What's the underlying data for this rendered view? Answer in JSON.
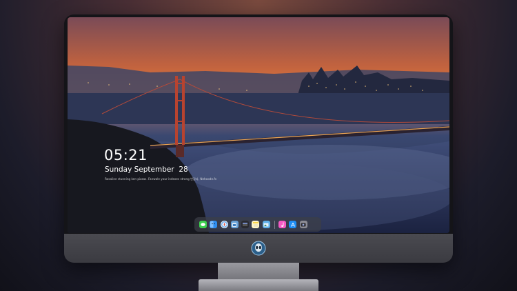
{
  "lock_screen": {
    "time": "05:21",
    "date": "Sunday September  28",
    "tagline": "Rosaline stunning ken pizzas. Fanwale your indexes strong 반갑다, Nehoode.fs"
  },
  "dock": {
    "apps": [
      {
        "name": "messages-icon",
        "color": "#3ccf4e"
      },
      {
        "name": "finder-icon",
        "color": "#2f8ef0"
      },
      {
        "name": "safari-icon",
        "color": "#e9eef5"
      },
      {
        "name": "preview-icon",
        "color": "#6aa3d9"
      },
      {
        "name": "final-cut-icon",
        "color": "#2a2a30"
      },
      {
        "name": "notes-icon",
        "color": "#f7d44c"
      },
      {
        "name": "photos-icon",
        "color": "#5fb0e8"
      },
      {
        "name": "itunes-icon",
        "color": "#f45ac4"
      },
      {
        "name": "app-store-icon",
        "color": "#1e8ef5"
      },
      {
        "name": "camera-icon",
        "color": "#8c8c94"
      }
    ]
  }
}
